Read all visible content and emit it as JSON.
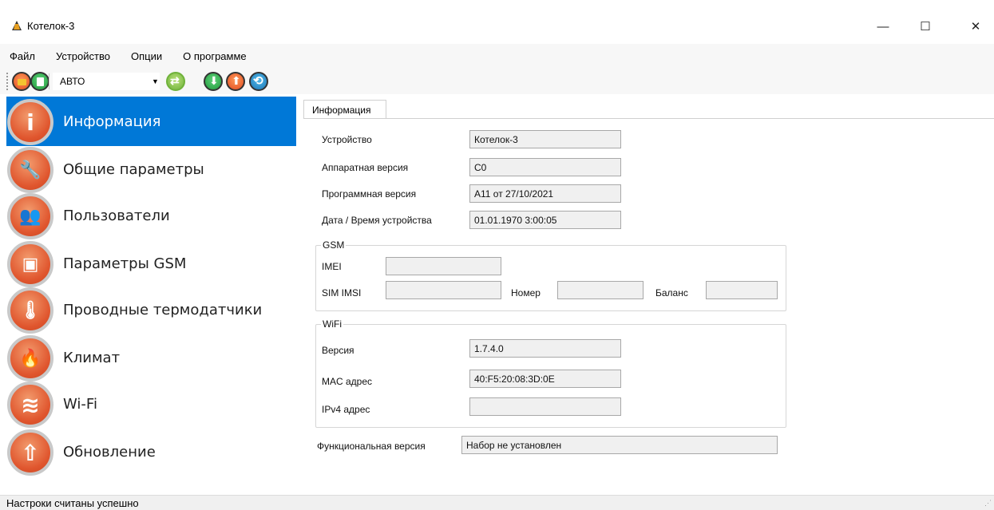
{
  "window": {
    "title": "Котелок-3",
    "minimize_glyph": "—",
    "maximize_glyph": "☐",
    "close_glyph": "✕"
  },
  "menu": {
    "items": [
      "Файл",
      "Устройство",
      "Опции",
      "О программе"
    ]
  },
  "toolbar": {
    "mode_value": "АВТО",
    "icons": [
      "open-folder-icon",
      "save-icon",
      "sync-icon",
      "download-icon",
      "upload-icon",
      "refresh-icon"
    ]
  },
  "sidebar": {
    "active_color": "#0078d7",
    "items": [
      {
        "label": "Информация",
        "icon": "info-icon",
        "glyph": "i",
        "active": true
      },
      {
        "label": "Общие параметры",
        "icon": "wrench-icon",
        "glyph": "🔧",
        "active": false
      },
      {
        "label": "Пользователи",
        "icon": "users-icon",
        "glyph": "👥",
        "active": false
      },
      {
        "label": "Параметры GSM",
        "icon": "sim-card-icon",
        "glyph": "▣",
        "active": false
      },
      {
        "label": "Проводные термодатчики",
        "icon": "thermometer-icon",
        "glyph": "🌡",
        "active": false
      },
      {
        "label": "Климат",
        "icon": "flame-icon",
        "glyph": "🔥",
        "active": false
      },
      {
        "label": "Wi-Fi",
        "icon": "wifi-icon",
        "glyph": "≋",
        "active": false
      },
      {
        "label": "Обновление",
        "icon": "update-arrow-icon",
        "glyph": "⇧",
        "active": false
      }
    ]
  },
  "tabs": {
    "active": "Информация"
  },
  "info": {
    "device_label": "Устройство",
    "device_value": "Котелок-3",
    "hw_label": "Аппаратная версия",
    "hw_value": "C0",
    "sw_label": "Программная версия",
    "sw_value": "A11 от 27/10/2021",
    "datetime_label": "Дата / Время устройства",
    "datetime_value": "01.01.1970 3:00:05"
  },
  "gsm": {
    "legend": "GSM",
    "imei_label": "IMEI",
    "imei_value": "",
    "imsi_label": "SIM IMSI",
    "imsi_value": "",
    "number_label": "Номер",
    "number_value": "",
    "balance_label": "Баланс",
    "balance_value": ""
  },
  "wifi": {
    "legend": "WiFi",
    "version_label": "Версия",
    "version_value": "1.7.4.0",
    "mac_label": "MAC адрес",
    "mac_value": "40:F5:20:08:3D:0E",
    "ipv4_label": "IPv4 адрес",
    "ipv4_value": ""
  },
  "functional": {
    "label": "Функциональная версия",
    "value": "Набор не установлен"
  },
  "status": {
    "text": "Настроки считаны успешно"
  }
}
